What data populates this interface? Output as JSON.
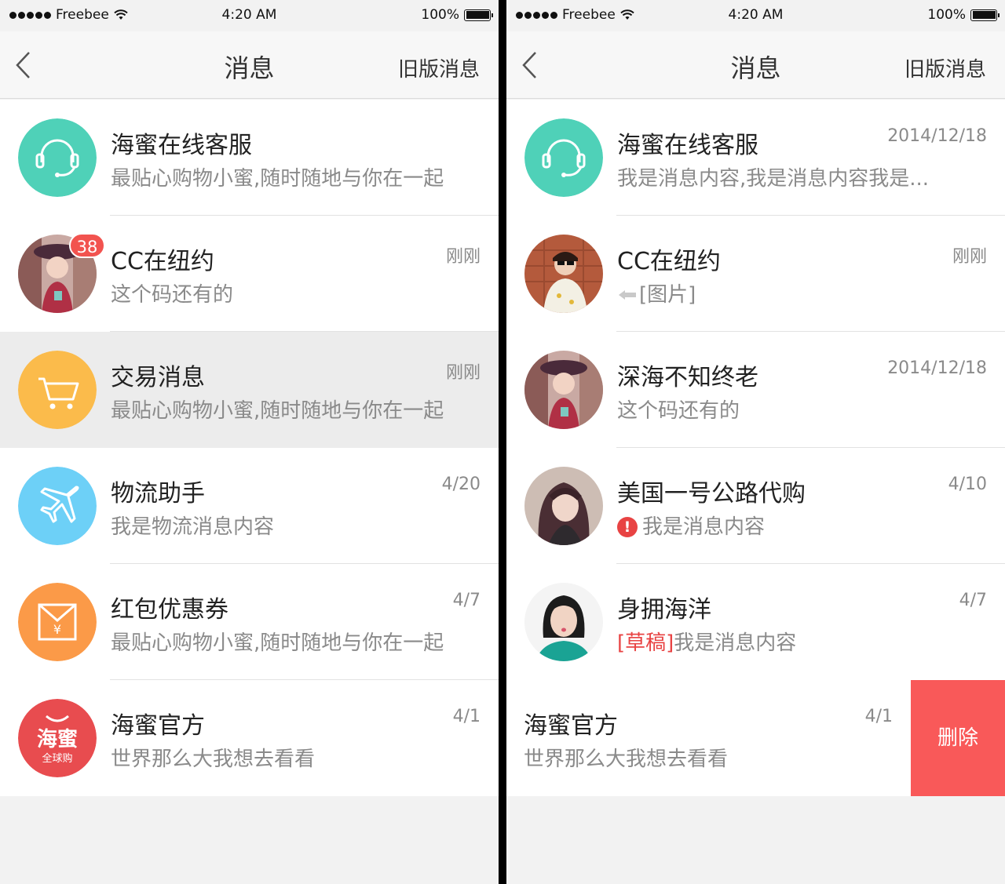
{
  "status_bar": {
    "carrier": "Freebee",
    "time": "4:20 AM",
    "battery": "100%",
    "battery_level": 1.0
  },
  "left_screen": {
    "nav": {
      "title": "消息",
      "right": "旧版消息"
    },
    "items": [
      {
        "name": "海蜜在线客服",
        "message": "最贴心购物小蜜,随时随地与你在一起",
        "time": "",
        "icon": "headset-icon"
      },
      {
        "name": "CC在纽约",
        "message": "这个码还有的",
        "time": "刚刚",
        "badge": "38",
        "icon": "user-avatar"
      },
      {
        "name": "交易消息",
        "message": "最贴心购物小蜜,随时随地与你在一起",
        "time": "刚刚",
        "icon": "cart-icon"
      },
      {
        "name": "物流助手",
        "message": "我是物流消息内容",
        "time": "4/20",
        "icon": "airplane-icon"
      },
      {
        "name": "红包优惠券",
        "message": "最贴心购物小蜜,随时随地与你在一起",
        "time": "4/7",
        "icon": "envelope-icon"
      },
      {
        "name": "海蜜官方",
        "message": "世界那么大我想去看看",
        "time": "4/1",
        "icon": "haimi-logo",
        "logo_text": "海蜜",
        "logo_sub": "全球购"
      }
    ]
  },
  "right_screen": {
    "nav": {
      "title": "消息",
      "right": "旧版消息"
    },
    "items": [
      {
        "name": "海蜜在线客服",
        "message": "我是消息内容,我是消息内容我是...",
        "time": "2014/12/18",
        "icon": "headset-icon"
      },
      {
        "name": "CC在纽约",
        "message": "[图片]",
        "time": "刚刚",
        "icon": "user-avatar"
      },
      {
        "name": "深海不知终老",
        "message": "这个码还有的",
        "time": "2014/12/18",
        "icon": "user-avatar"
      },
      {
        "name": "美国一号公路代购",
        "message": "我是消息内容",
        "time": "4/10",
        "icon": "user-avatar"
      },
      {
        "name": "身拥海洋",
        "draft": "[草稿]",
        "message": "我是消息内容",
        "time": "4/7",
        "icon": "user-avatar"
      },
      {
        "name": "海蜜官方",
        "message": "世界那么大我想去看看",
        "time": "4/1",
        "delete_label": "删除"
      }
    ]
  },
  "colors": {
    "teal": "#4fd1b8",
    "yellow": "#fbbb4b",
    "sky": "#6dd0f7",
    "orange": "#fb9a48",
    "red": "#e84c4f",
    "delete": "#f95959"
  }
}
